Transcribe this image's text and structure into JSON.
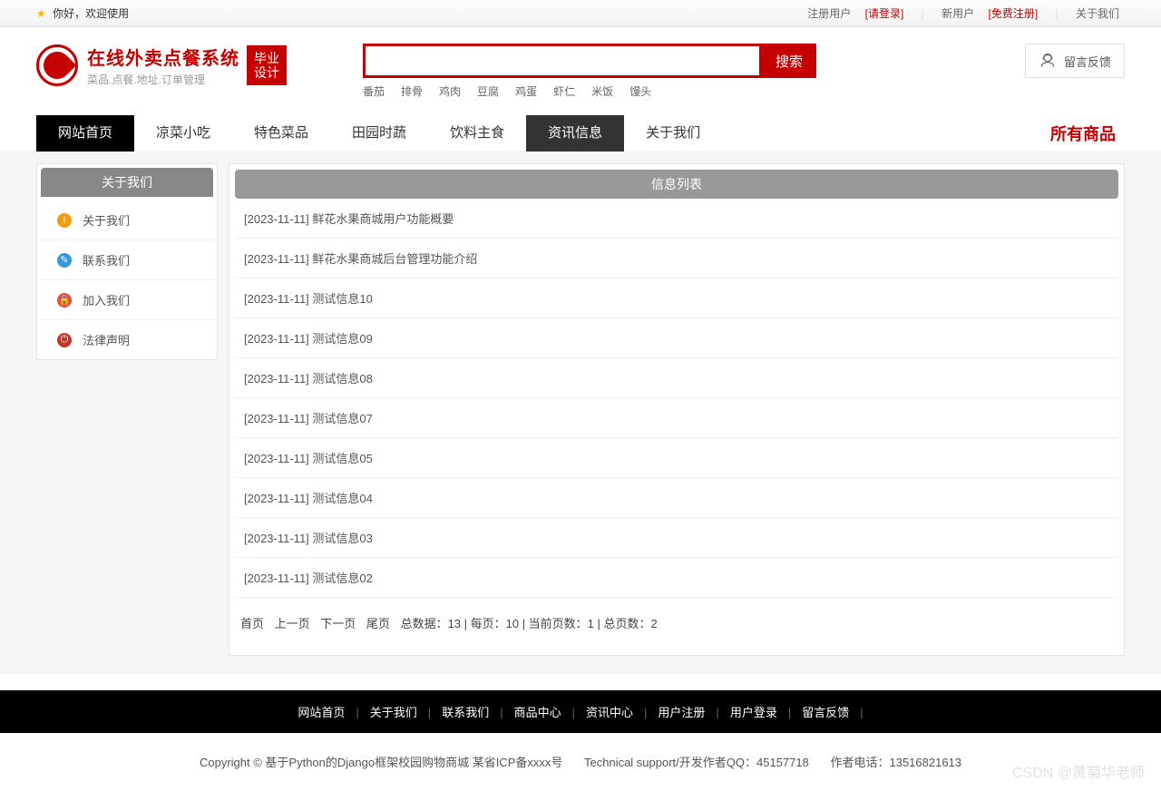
{
  "topbar": {
    "welcome": "你好，欢迎使用",
    "reg_user_label": "注册用户",
    "login_link": "[请登录]",
    "new_user_label": "新用户",
    "free_reg_link": "[免费注册]",
    "about_link": "关于我们"
  },
  "logo": {
    "title": "在线外卖点餐系统",
    "subtitle": "菜品.点餐.地址.订单管理",
    "badge_line1": "毕业",
    "badge_line2": "设计"
  },
  "search": {
    "button": "搜索",
    "placeholder": "",
    "hotwords": [
      "番茄",
      "排骨",
      "鸡肉",
      "豆腐",
      "鸡蛋",
      "虾仁",
      "米饭",
      "馒头"
    ]
  },
  "feedback_btn": "留言反馈",
  "nav": {
    "items": [
      "网站首页",
      "凉菜小吃",
      "特色菜品",
      "田园时蔬",
      "饮料主食",
      "资讯信息",
      "关于我们"
    ],
    "active_index": 5,
    "dark_index": 0,
    "all_products": "所有商品"
  },
  "sidebar": {
    "title": "关于我们",
    "items": [
      {
        "label": "关于我们",
        "icon": "info",
        "color": "orange"
      },
      {
        "label": "联系我们",
        "icon": "contact",
        "color": "blue"
      },
      {
        "label": "加入我们",
        "icon": "lock",
        "color": "red"
      },
      {
        "label": "法律声明",
        "icon": "power",
        "color": "redd"
      }
    ]
  },
  "content": {
    "title": "信息列表",
    "rows": [
      {
        "date": "[2023-11-11]",
        "title": "鲜花水果商城用户功能概要"
      },
      {
        "date": "[2023-11-11]",
        "title": "鲜花水果商城后台管理功能介绍"
      },
      {
        "date": "[2023-11-11]",
        "title": "测试信息10"
      },
      {
        "date": "[2023-11-11]",
        "title": "测试信息09"
      },
      {
        "date": "[2023-11-11]",
        "title": "测试信息08"
      },
      {
        "date": "[2023-11-11]",
        "title": "测试信息07"
      },
      {
        "date": "[2023-11-11]",
        "title": "测试信息05"
      },
      {
        "date": "[2023-11-11]",
        "title": "测试信息04"
      },
      {
        "date": "[2023-11-11]",
        "title": "测试信息03"
      },
      {
        "date": "[2023-11-11]",
        "title": "测试信息02"
      }
    ]
  },
  "pager": {
    "first": "首页",
    "prev": "上一页",
    "next": "下一页",
    "last": "尾页",
    "stats": "总数据：13 | 每页：10 | 当前页数：1 | 总页数：2"
  },
  "footer_nav": [
    "网站首页",
    "关于我们",
    "联系我们",
    "商品中心",
    "资讯中心",
    "用户注册",
    "用户登录",
    "留言反馈"
  ],
  "footer_copy": {
    "line1a": "Copyright © 基于Python的Django框架校园购物商城 某省ICP备xxxx号",
    "line1b": "Technical support/开发作者QQ：45157718",
    "line1c": "作者电话：13516821613"
  },
  "watermark": "CSDN @黄菊华老师"
}
